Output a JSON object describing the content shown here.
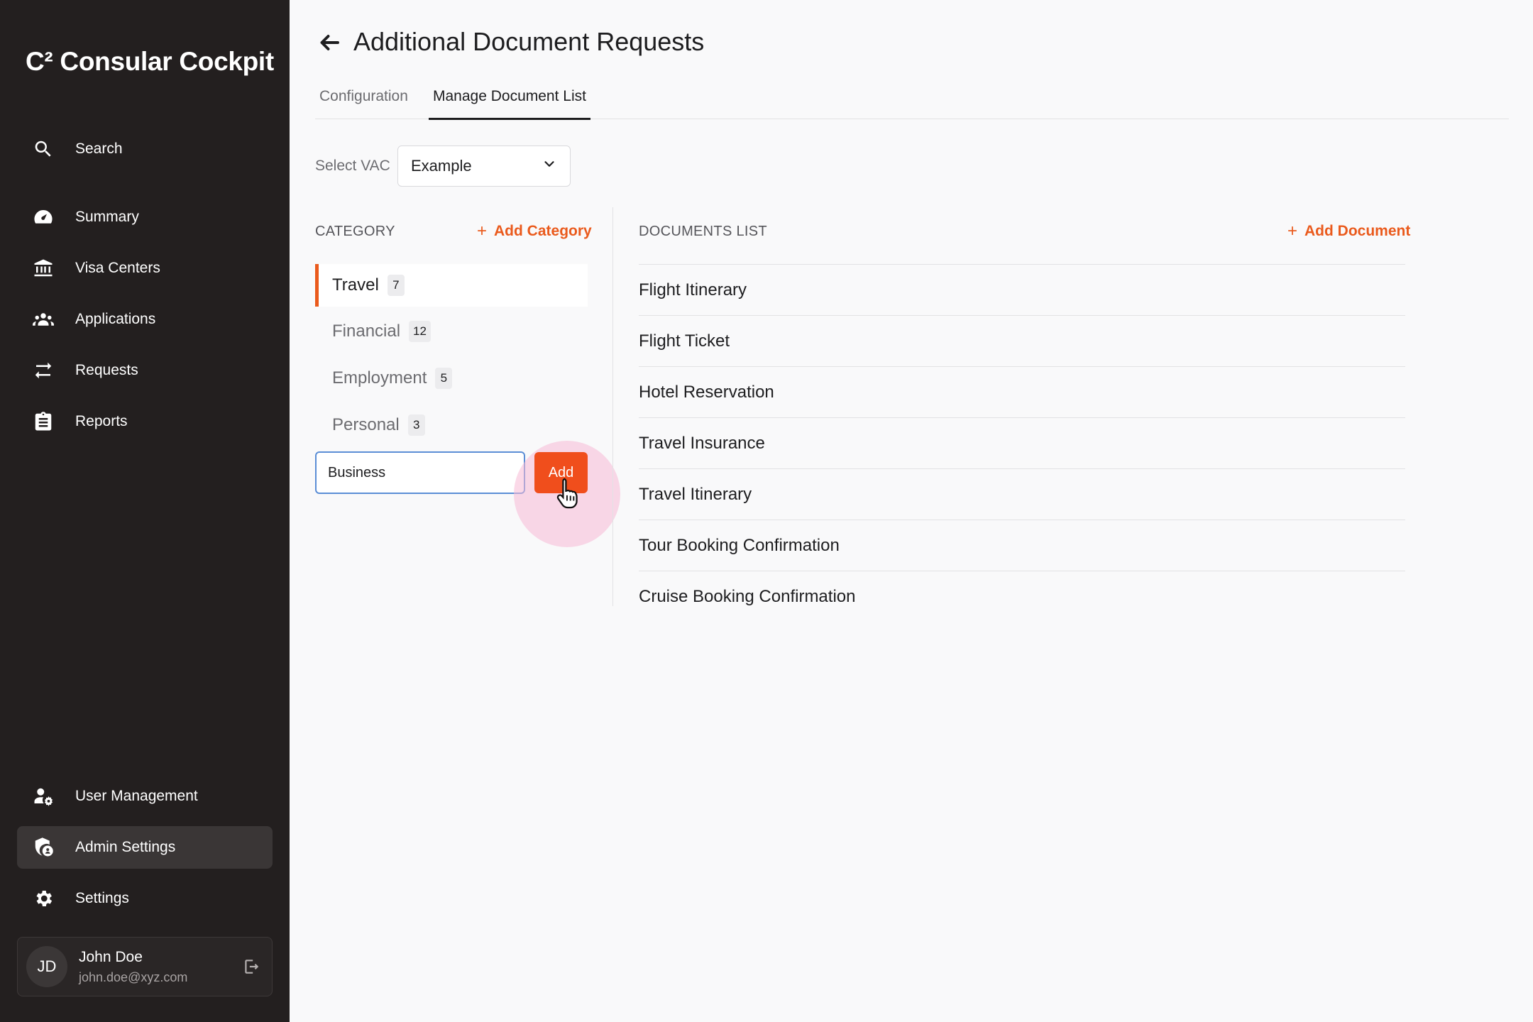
{
  "app": {
    "title": "C² Consular Cockpit"
  },
  "sidebar": {
    "items": [
      {
        "label": "Search",
        "icon": "search-icon"
      },
      {
        "label": "Summary",
        "icon": "gauge-icon"
      },
      {
        "label": "Visa Centers",
        "icon": "bank-icon"
      },
      {
        "label": "Applications",
        "icon": "users-icon"
      },
      {
        "label": "Requests",
        "icon": "swap-icon"
      },
      {
        "label": "Reports",
        "icon": "clipboard-icon"
      }
    ],
    "bottom_items": [
      {
        "label": "User Management",
        "icon": "user-gear-icon"
      },
      {
        "label": "Admin Settings",
        "icon": "shield-user-icon",
        "active": true
      },
      {
        "label": "Settings",
        "icon": "gear-icon"
      }
    ],
    "user": {
      "initials": "JD",
      "name": "John Doe",
      "email": "john.doe@xyz.com"
    }
  },
  "page": {
    "title": "Additional Document Requests"
  },
  "tabs": [
    {
      "label": "Configuration",
      "active": false
    },
    {
      "label": "Manage Document List",
      "active": true
    }
  ],
  "vac": {
    "label": "Select VAC",
    "selected": "Example"
  },
  "categories": {
    "header": "CATEGORY",
    "add_label": "Add Category",
    "items": [
      {
        "name": "Travel",
        "count": "7",
        "active": true
      },
      {
        "name": "Financial",
        "count": "12",
        "active": false
      },
      {
        "name": "Employment",
        "count": "5",
        "active": false
      },
      {
        "name": "Personal",
        "count": "3",
        "active": false
      }
    ],
    "new_input_value": "Business",
    "add_button": "Add"
  },
  "documents": {
    "header": "DOCUMENTS LIST",
    "add_label": "Add Document",
    "items": [
      "Flight Itinerary",
      "Flight Ticket",
      "Hotel Reservation",
      "Travel Insurance",
      "Travel Itinerary",
      "Tour Booking Confirmation",
      "Cruise Booking Confirmation"
    ]
  },
  "colors": {
    "accent": "#ea5a1c",
    "sidebar_bg": "#231f1f",
    "input_focus": "#5b8ed6"
  }
}
